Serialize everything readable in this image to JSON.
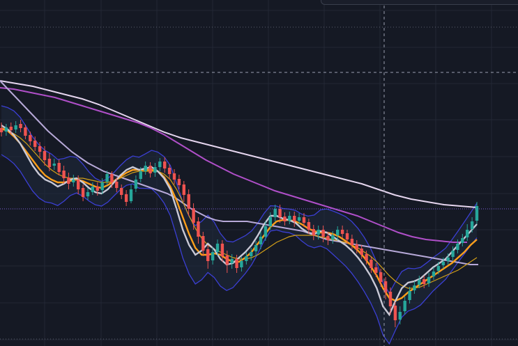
{
  "chart_data": {
    "type": "candlestick",
    "grid": true,
    "colors": {
      "background": "#151924",
      "grid": "#222735",
      "up": "#26a69a",
      "down": "#ef5350",
      "band": "#3b3fd4",
      "band_fill": "#1f2a3d",
      "ma_fast": "#c9c9d6",
      "ma_orange": "#ff9f1a",
      "ma_gold": "#d4a017",
      "ma_slow_light": "#b7a9d8",
      "ma_magenta": "#b04fc9",
      "ma_longest": "#e6d6ef",
      "crosshair": "#9aa0b0",
      "price_line": "#7b5fd6"
    },
    "price_scale": {
      "min": 0,
      "max": 497
    },
    "candles": [
      [
        184,
        190,
        176,
        196
      ],
      [
        189,
        183,
        178,
        195
      ],
      [
        182,
        187,
        176,
        193
      ],
      [
        186,
        180,
        174,
        191
      ],
      [
        178,
        184,
        172,
        190
      ],
      [
        183,
        195,
        179,
        200
      ],
      [
        194,
        203,
        189,
        209
      ],
      [
        202,
        211,
        196,
        217
      ],
      [
        210,
        218,
        204,
        226
      ],
      [
        217,
        230,
        210,
        238
      ],
      [
        228,
        240,
        220,
        246
      ],
      [
        238,
        235,
        228,
        244
      ],
      [
        234,
        247,
        229,
        252
      ],
      [
        245,
        256,
        238,
        264
      ],
      [
        255,
        264,
        248,
        272
      ],
      [
        262,
        258,
        251,
        268
      ],
      [
        258,
        272,
        252,
        279
      ],
      [
        270,
        283,
        265,
        289
      ],
      [
        282,
        276,
        270,
        287
      ],
      [
        276,
        268,
        262,
        280
      ],
      [
        268,
        274,
        262,
        281
      ],
      [
        273,
        262,
        256,
        279
      ],
      [
        261,
        250,
        245,
        266
      ],
      [
        250,
        262,
        246,
        270
      ],
      [
        261,
        270,
        255,
        276
      ],
      [
        270,
        280,
        265,
        286
      ],
      [
        279,
        290,
        273,
        296
      ],
      [
        289,
        272,
        265,
        292
      ],
      [
        271,
        258,
        252,
        276
      ],
      [
        257,
        246,
        240,
        262
      ],
      [
        246,
        238,
        232,
        251
      ],
      [
        238,
        249,
        233,
        255
      ],
      [
        248,
        240,
        234,
        254
      ],
      [
        240,
        232,
        227,
        246
      ],
      [
        232,
        242,
        226,
        248
      ],
      [
        241,
        250,
        236,
        257
      ],
      [
        249,
        258,
        243,
        265
      ],
      [
        257,
        266,
        251,
        272
      ],
      [
        265,
        280,
        260,
        290
      ],
      [
        279,
        300,
        272,
        310
      ],
      [
        299,
        320,
        292,
        330
      ],
      [
        318,
        340,
        312,
        350
      ],
      [
        339,
        360,
        333,
        368
      ],
      [
        358,
        375,
        352,
        386
      ],
      [
        374,
        362,
        355,
        380
      ],
      [
        362,
        350,
        344,
        368
      ],
      [
        350,
        368,
        345,
        376
      ],
      [
        367,
        380,
        360,
        392
      ],
      [
        378,
        372,
        365,
        386
      ],
      [
        372,
        385,
        366,
        392
      ],
      [
        384,
        375,
        369,
        390
      ],
      [
        375,
        368,
        362,
        380
      ],
      [
        368,
        362,
        356,
        374
      ],
      [
        361,
        352,
        346,
        368
      ],
      [
        351,
        340,
        333,
        358
      ],
      [
        340,
        325,
        318,
        346
      ],
      [
        325,
        312,
        305,
        330
      ],
      [
        312,
        300,
        294,
        318
      ],
      [
        300,
        312,
        294,
        320
      ],
      [
        311,
        318,
        305,
        324
      ],
      [
        317,
        310,
        304,
        322
      ],
      [
        310,
        318,
        304,
        326
      ],
      [
        317,
        312,
        306,
        322
      ],
      [
        312,
        320,
        306,
        326
      ],
      [
        319,
        330,
        314,
        336
      ],
      [
        329,
        338,
        323,
        345
      ],
      [
        337,
        330,
        324,
        344
      ],
      [
        330,
        340,
        324,
        348
      ],
      [
        339,
        345,
        333,
        352
      ],
      [
        344,
        338,
        332,
        350
      ],
      [
        338,
        330,
        325,
        345
      ],
      [
        330,
        336,
        324,
        342
      ],
      [
        335,
        344,
        330,
        350
      ],
      [
        343,
        352,
        337,
        358
      ],
      [
        351,
        358,
        345,
        364
      ],
      [
        357,
        366,
        352,
        372
      ],
      [
        365,
        374,
        360,
        380
      ],
      [
        373,
        385,
        368,
        392
      ],
      [
        384,
        392,
        378,
        398
      ],
      [
        391,
        405,
        386,
        412
      ],
      [
        404,
        420,
        398,
        430
      ],
      [
        419,
        440,
        413,
        452
      ],
      [
        439,
        460,
        434,
        470
      ],
      [
        459,
        448,
        440,
        466
      ],
      [
        447,
        432,
        426,
        452
      ],
      [
        431,
        418,
        412,
        436
      ],
      [
        417,
        410,
        404,
        422
      ],
      [
        409,
        402,
        396,
        414
      ],
      [
        401,
        408,
        396,
        414
      ],
      [
        407,
        398,
        392,
        412
      ],
      [
        397,
        390,
        384,
        402
      ],
      [
        389,
        382,
        376,
        394
      ],
      [
        381,
        376,
        370,
        386
      ],
      [
        375,
        370,
        364,
        380
      ],
      [
        369,
        360,
        354,
        374
      ],
      [
        359,
        350,
        344,
        364
      ],
      [
        349,
        342,
        336,
        354
      ],
      [
        341,
        330,
        322,
        346
      ],
      [
        329,
        318,
        312,
        334
      ],
      [
        317,
        296,
        290,
        322
      ]
    ],
    "ma_fast": [
      180,
      186,
      194,
      206,
      222,
      238,
      250,
      258,
      262,
      268,
      264,
      258,
      256,
      262,
      270,
      276,
      278,
      272,
      262,
      252,
      244,
      240,
      244,
      242,
      240,
      246,
      256,
      272,
      300,
      330,
      352,
      366,
      360,
      350,
      358,
      372,
      380,
      378,
      370,
      362,
      352,
      338,
      322,
      310,
      310,
      314,
      316,
      320,
      328,
      334,
      336,
      332,
      334,
      340,
      346,
      352,
      360,
      370,
      382,
      396,
      414,
      440,
      452,
      432,
      414,
      406,
      404,
      400,
      392,
      384,
      378,
      372,
      362,
      352,
      342,
      332,
      322
    ],
    "ma_orange": [
      184,
      188,
      196,
      206,
      218,
      230,
      242,
      252,
      258,
      262,
      262,
      260,
      258,
      260,
      264,
      268,
      270,
      266,
      260,
      254,
      248,
      244,
      244,
      244,
      244,
      246,
      254,
      268,
      288,
      312,
      336,
      356,
      366,
      366,
      364,
      366,
      372,
      376,
      376,
      370,
      362,
      350,
      338,
      326,
      318,
      316,
      316,
      318,
      322,
      328,
      332,
      334,
      334,
      336,
      340,
      346,
      352,
      360,
      370,
      382,
      396,
      414,
      428,
      432,
      428,
      420,
      414,
      408,
      402,
      396,
      390,
      384,
      378,
      370,
      362,
      352,
      344
    ],
    "ma_gold": [
      186,
      188,
      192,
      198,
      206,
      216,
      226,
      236,
      244,
      250,
      254,
      256,
      256,
      256,
      258,
      260,
      262,
      262,
      260,
      256,
      252,
      248,
      246,
      246,
      246,
      246,
      250,
      258,
      272,
      290,
      310,
      328,
      342,
      352,
      358,
      362,
      366,
      370,
      372,
      372,
      370,
      366,
      360,
      354,
      348,
      344,
      340,
      338,
      338,
      338,
      338,
      340,
      342,
      344,
      346,
      348,
      352,
      356,
      362,
      368,
      376,
      386,
      396,
      404,
      410,
      414,
      414,
      412,
      408,
      404,
      400,
      396,
      392,
      388,
      382,
      376,
      370
    ],
    "ma_slow_light": [
      116,
      128,
      140,
      152,
      164,
      176,
      188,
      198,
      208,
      218,
      226,
      234,
      240,
      246,
      250,
      254,
      258,
      262,
      266,
      270,
      274,
      278,
      284,
      292,
      300,
      306,
      312,
      316,
      318,
      318,
      318,
      318,
      320,
      322,
      324,
      326,
      328,
      330,
      332,
      336,
      340,
      344,
      346,
      348,
      350,
      352,
      354,
      356,
      358,
      360,
      362,
      364,
      366,
      368,
      370,
      372,
      374,
      376,
      378,
      380,
      380
    ],
    "ma_magenta": [
      126,
      128,
      132,
      136,
      140,
      146,
      152,
      158,
      164,
      170,
      176,
      184,
      194,
      206,
      218,
      230,
      240,
      250,
      258,
      266,
      274,
      280,
      286,
      292,
      298,
      304,
      310,
      318,
      326,
      334,
      340,
      344,
      346,
      348,
      348
    ],
    "ma_longest": [
      116,
      120,
      124,
      130,
      136,
      142,
      150,
      160,
      170,
      180,
      190,
      198,
      204,
      210,
      216,
      222,
      228,
      234,
      240,
      246,
      252,
      258,
      264,
      272,
      280,
      286,
      290,
      294,
      296,
      298
    ]
  }
}
